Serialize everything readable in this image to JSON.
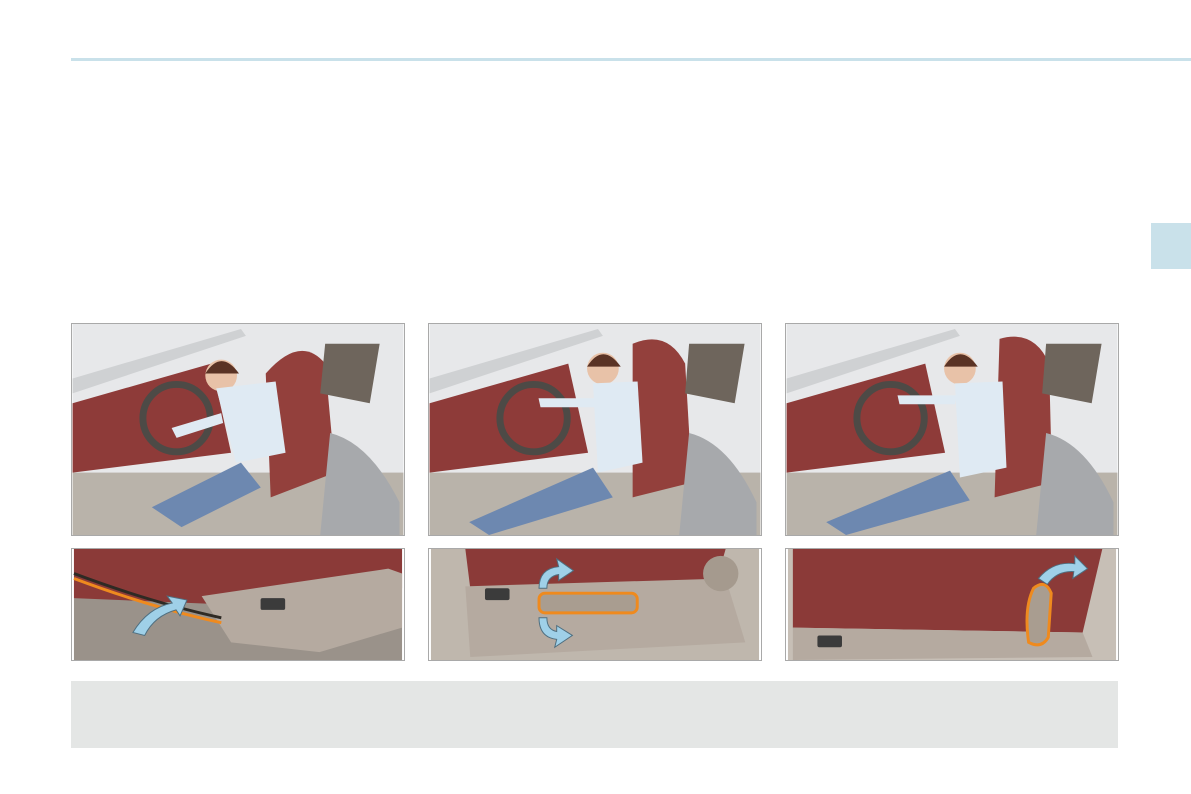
{
  "page": {
    "header_rule_color": "#c9e1ea",
    "section_tab_color": "#c9e1ea",
    "note_box_color": "#e4e6e5"
  },
  "illustrations": [
    {
      "id": "step-1",
      "scene": "driver-reaching-under-seat",
      "detail": "front-bar-lift-arrow"
    },
    {
      "id": "step-2",
      "scene": "driver-adjusting-side-control",
      "detail": "side-lever-up-down-arrows"
    },
    {
      "id": "step-3",
      "scene": "driver-leaning-back",
      "detail": "backrest-lever-rotate-arrow"
    }
  ],
  "colors": {
    "leather": "#8e3b39",
    "arrow": "#9fd0e8",
    "highlight": "#ef8a1e"
  }
}
